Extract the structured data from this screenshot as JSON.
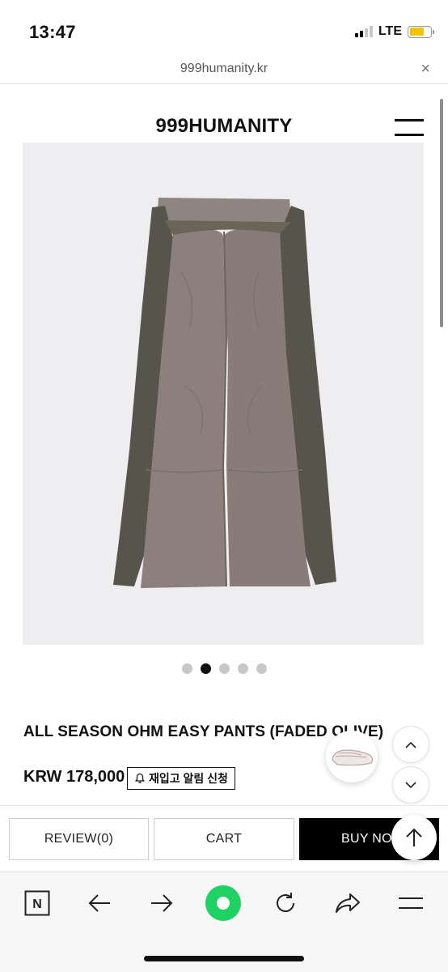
{
  "status_bar": {
    "time": "13:47",
    "network": "LTE"
  },
  "browser": {
    "url": "999humanity.kr",
    "close_label": "×"
  },
  "site": {
    "logo": "999HUMANITY"
  },
  "product": {
    "title": "ALL SEASON OHM EASY PANTS (FADED OLIVE)",
    "price": "KRW 178,000",
    "restock_label": "재입고 알림 신청",
    "image_count": 5,
    "active_image_index": 1
  },
  "actions": {
    "review_label": "REVIEW(0)",
    "cart_label": "CART",
    "buy_label": "BUY NOW"
  },
  "toolbar": {
    "naver_label": "N"
  },
  "colors": {
    "image_bg": "#eeeef0",
    "pants_light": "#8c7f7b",
    "pants_dark": "#56534a",
    "home_green": "#1fd264",
    "battery": "#f4c400"
  }
}
